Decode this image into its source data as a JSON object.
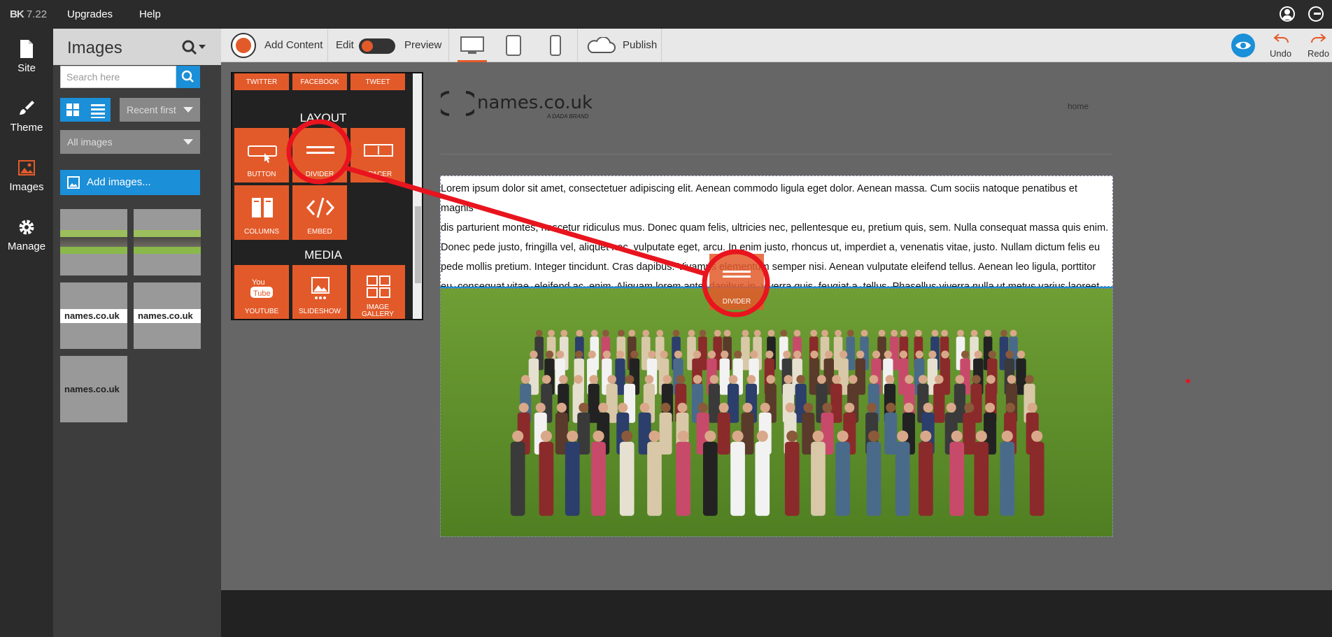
{
  "topbar": {
    "brand": "BK",
    "version": "7.22",
    "menu": [
      "Upgrades",
      "Help"
    ],
    "icons": [
      "account-icon",
      "logout-icon"
    ]
  },
  "rail": {
    "items": [
      {
        "label": "Site",
        "icon": "page-icon"
      },
      {
        "label": "Theme",
        "icon": "brush-icon"
      },
      {
        "label": "Images",
        "icon": "image-icon"
      },
      {
        "label": "Manage",
        "icon": "gear-icon"
      }
    ]
  },
  "panel": {
    "title": "Images",
    "search_placeholder": "Search here",
    "sort": "Recent first",
    "filter": "All images",
    "add_images": "Add images...",
    "thumb_names": [
      "group-photo",
      "group-photo",
      "names-logo",
      "names-logo",
      "names-logo"
    ],
    "logo_text": "names.co.uk"
  },
  "toolbar": {
    "add_content": "Add Content",
    "edit": "Edit",
    "preview": "Preview",
    "publish": "Publish",
    "undo": "Undo",
    "redo": "Redo",
    "devices": [
      "desktop-icon",
      "tablet-icon",
      "phone-icon"
    ]
  },
  "widgets": {
    "top_row": [
      "TWITTER",
      "FACEBOOK",
      "TWEET"
    ],
    "layout_title": "LAYOUT",
    "layout_row1": [
      "BUTTON",
      "DIVIDER",
      "SPACER"
    ],
    "layout_row2": [
      "COLUMNS",
      "EMBED"
    ],
    "media_title": "MEDIA",
    "media_row": [
      "YOUTUBE",
      "SLIDESHOW",
      "IMAGE GALLERY"
    ]
  },
  "page": {
    "logo": "names.co.uk",
    "logo_sub": "A DADA BRAND",
    "nav_home": "home",
    "lorem": "Lorem ipsum dolor sit amet, consectetuer adipiscing elit. Aenean commodo ligula eget dolor. Aenean massa. Cum sociis natoque penatibus et magnis\ndis parturient montes, nascetur ridiculus mus. Donec quam felis, ultricies nec, pellentesque eu, pretium quis, sem. Nulla consequat massa quis enim.\nDonec pede justo, fringilla vel, aliquet nec, vulputate eget, arcu. In enim justo, rhoncus ut, imperdiet a, venenatis vitae, justo. Nullam dictum felis eu\npede mollis pretium. Integer tincidunt. Cras dapibus. Vivamus elementum semper nisi. Aenean vulputate eleifend tellus. Aenean leo ligula, porttitor\neu, consequat vitae, eleifend ac, enim. Aliquam lorem ante, dapibus in, viverra quis, feugiat a, tellus. Phasellus viverra nulla ut metus varius laoreet."
  },
  "drag_ghost": "DIVIDER",
  "colors": {
    "accent_orange": "#e35a2a",
    "accent_blue": "#1b8fd8",
    "annotation_red": "#e8141e"
  }
}
